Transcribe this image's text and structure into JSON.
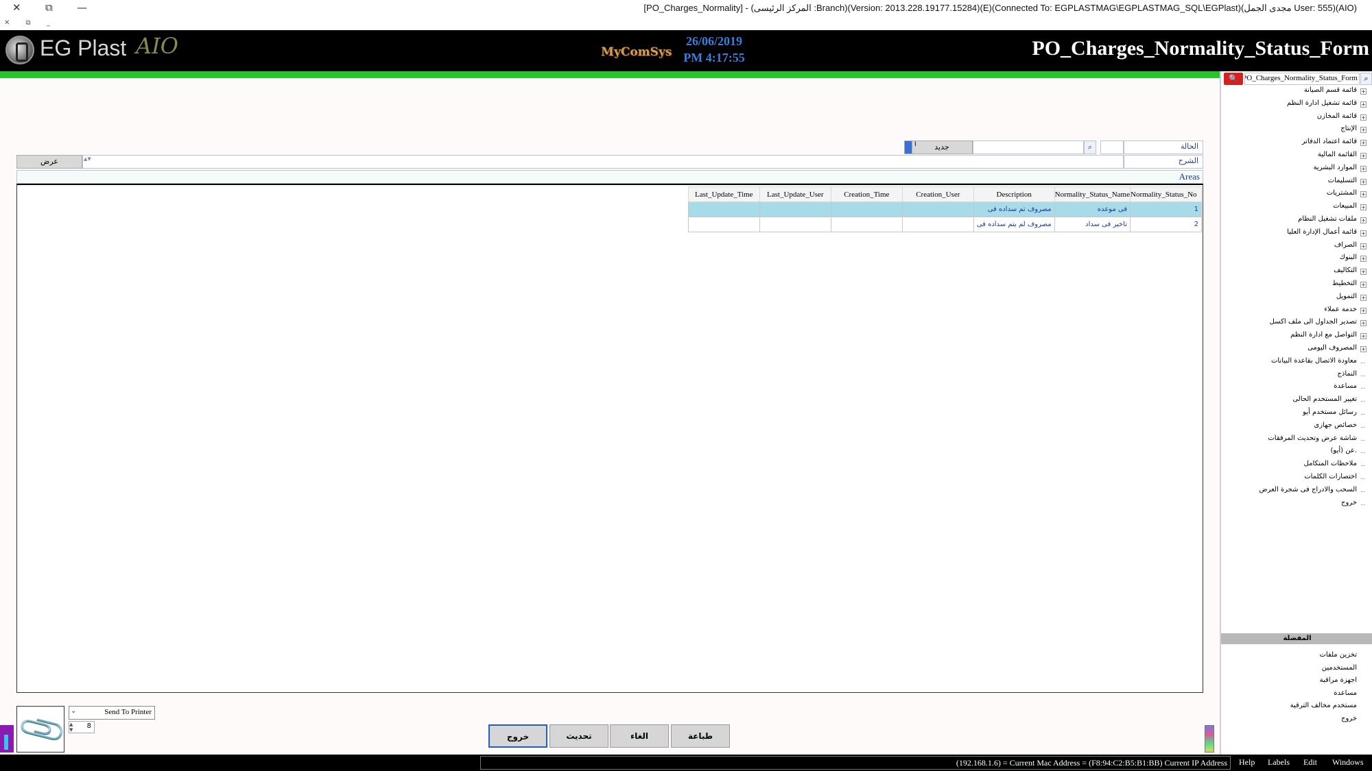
{
  "window": {
    "title": "[PO_Charges_Normality] - (المركز الرئيسى :Branch)(Version: 2013.228.19177.15284)(E)(Connected To: EGPLASTMAG\\EGPLASTMAG_SQL\\EGPlast)(مجدى الجمل User: 555)(AIO)",
    "close_glyph": "✕",
    "restore_glyph": "⧉",
    "minimize_glyph": "—",
    "mdi_controls": "✕ ⧉ _"
  },
  "header": {
    "logo_text": "EG Plast",
    "logo_aio": "AIO",
    "brand": "MyComSys",
    "date": "26/06/2019",
    "time": "PM 4:17:55",
    "form_name": "PO_Charges_Normality_Status_Form"
  },
  "form": {
    "status_label": "الحالة",
    "description_label": "الشرح",
    "new_button": "جديد",
    "new_indicator": "I",
    "view_button": "عرض",
    "search_icon": "⌕",
    "spin_glyph": "▲▼"
  },
  "grid": {
    "title": "Areas",
    "columns": [
      "Last_Update_Time",
      "Last_Update_User",
      "Creation_Time",
      "Creation_User",
      "Description",
      "Normality_Status_Name",
      "Normality_Status_No"
    ],
    "rows": [
      {
        "Last_Update_Time": "",
        "Last_Update_User": "",
        "Creation_Time": "",
        "Creation_User": "",
        "Description": "مصروف تم سداده فى",
        "Normality_Status_Name": "فى موعده",
        "Normality_Status_No": "1",
        "selected": true
      },
      {
        "Last_Update_Time": "",
        "Last_Update_User": "",
        "Creation_Time": "",
        "Creation_User": "",
        "Description": "مصروف لم يتم سداده فى",
        "Normality_Status_Name": "تاخير فى سداد",
        "Normality_Status_No": "2",
        "selected": false
      }
    ]
  },
  "bottom": {
    "attach_icon": "📎",
    "printer_select": "Send To Printer",
    "copies": "8",
    "buttons": {
      "print": "طباعة",
      "cancel": "الغاء",
      "refresh": "تحديث",
      "exit": "خروج"
    }
  },
  "sidebar": {
    "search_value": "PO_Charges_Normality_Status_Form",
    "search_button_icon": "🔍",
    "tree": [
      {
        "label": "قائمة قسم الصيانة",
        "expandable": true
      },
      {
        "label": "قائمة تشغيل ادارة النظم",
        "expandable": true
      },
      {
        "label": "قائمة المخازن",
        "expandable": true
      },
      {
        "label": "الإنتاج",
        "expandable": true
      },
      {
        "label": "قائمة اعتماد الدفاتر",
        "expandable": true
      },
      {
        "label": "القائمة المالية",
        "expandable": true
      },
      {
        "label": "الموارد البشرية",
        "expandable": true
      },
      {
        "label": "التسليمات",
        "expandable": true
      },
      {
        "label": "المشتريات",
        "expandable": true
      },
      {
        "label": "المبيعات",
        "expandable": true
      },
      {
        "label": "ملفات تشغيل النظام",
        "expandable": true
      },
      {
        "label": "قائمة أعمال الإدارة العليا",
        "expandable": true
      },
      {
        "label": "الصراف",
        "expandable": true
      },
      {
        "label": "البنوك",
        "expandable": true
      },
      {
        "label": "التكاليف",
        "expandable": true
      },
      {
        "label": "التخطيط",
        "expandable": true
      },
      {
        "label": "التمويل",
        "expandable": true
      },
      {
        "label": "خدمة عملاء",
        "expandable": true
      },
      {
        "label": "تصدير الجداول الى ملف اكسل",
        "expandable": true
      },
      {
        "label": "التواصل مع ادارة النظم",
        "expandable": true
      },
      {
        "label": "المصروف اليومى",
        "expandable": true
      },
      {
        "label": "معاودة الاتصال بقاعدة البيانات",
        "expandable": false
      },
      {
        "label": "النماذج",
        "expandable": false
      },
      {
        "label": "مساعدة",
        "expandable": false
      },
      {
        "label": "تغيير المستخدم الحالى",
        "expandable": false
      },
      {
        "label": "رسائل مستخدم أيو",
        "expandable": false
      },
      {
        "label": "خصائص جهازى",
        "expandable": false
      },
      {
        "label": "شاشة عرض وتحديث المرفقات",
        "expandable": false
      },
      {
        "label": "عن (أيو).",
        "expandable": false
      },
      {
        "label": "ملاحظات المتكامل",
        "expandable": false
      },
      {
        "label": "اختصارات الكلمات",
        "expandable": false
      },
      {
        "label": "السحب والادراج فى شجرة العرض",
        "expandable": false
      },
      {
        "label": "خروج",
        "expandable": false
      }
    ],
    "favorites_title": "المفضلة",
    "favorites": [
      "تخزين ملفات",
      "المستخدمين",
      "اجهزة مراقبة",
      "مساعدة",
      "مستخدم مخالف الترقية",
      "خروج"
    ]
  },
  "statusbar": {
    "ip_info": "(192.168.1.6) = Current Mac Address = (F8:94:C2:B5:B1:BB) Current IP Address",
    "menu": [
      "Help",
      "Labels",
      "Edit",
      "Windows"
    ]
  },
  "colors": {
    "green_bar": "#27c42b",
    "header_bg": "#000000",
    "date_blue": "#3a7fe0",
    "selected_row": "#a8dbe8"
  }
}
